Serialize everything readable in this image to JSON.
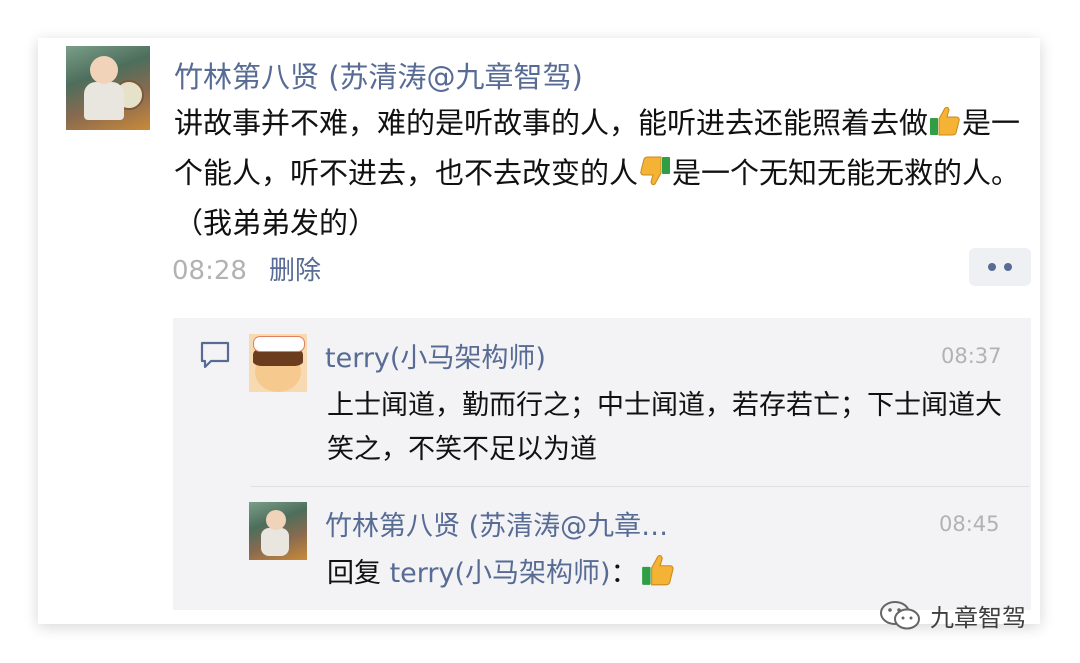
{
  "post": {
    "author": "竹林第八贤 (苏清涛@九章智驾)",
    "text_part1": "讲故事并不难，难的是听故事的人，能听进去还能照着去做",
    "text_part2": "是一个能人，听不进去，也不去改变的人",
    "text_part3": "是一个无知无能无救的人。（我弟弟发的）",
    "time": "08:28",
    "delete_label": "删除"
  },
  "comments": [
    {
      "author": "terry(小马架构师)",
      "time": "08:37",
      "text": "上士闻道，勤而行之；中士闻道，若存若亡；下士闻道大笑之，不笑不足以为道"
    },
    {
      "author": "竹林第八贤 (苏清涛@九章…",
      "time": "08:45",
      "reply_prefix": "回复",
      "reply_to": "terry(小马架构师)",
      "reply_suffix": "："
    }
  ],
  "watermark": "九章智驾",
  "icons": {
    "more": "more-dots-icon",
    "comment": "comment-icon",
    "thumbs_up": "thumbs-up-emoji",
    "thumbs_down": "thumbs-down-emoji",
    "wechat": "wechat-icon"
  },
  "colors": {
    "link": "#576b95",
    "meta": "#b2b2b2",
    "comment_bg": "#f3f3f5"
  }
}
